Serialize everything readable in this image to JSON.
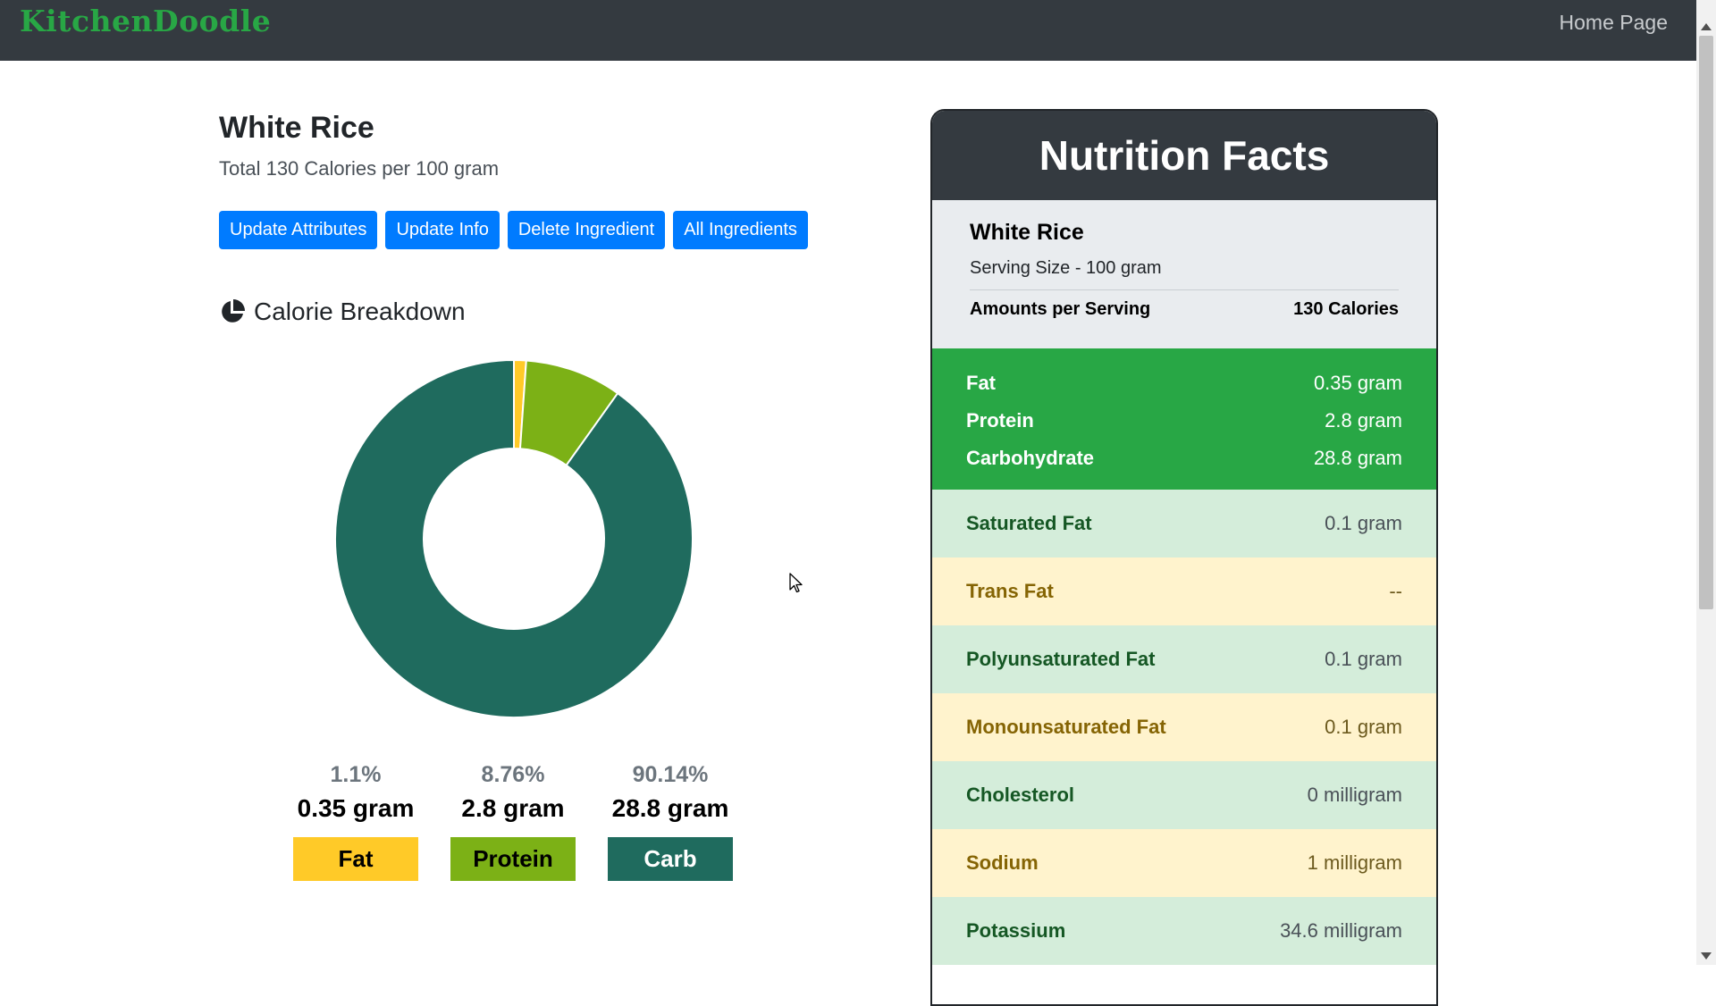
{
  "navbar": {
    "brand": "KitchenDoodle",
    "home_link": "Home Page"
  },
  "ingredient": {
    "name": "White Rice",
    "subtitle": "Total 130 Calories per 100 gram"
  },
  "actions": [
    "Update Attributes",
    "Update Info",
    "Delete Ingredient",
    "All Ingredients"
  ],
  "breakdown": {
    "title": "Calorie Breakdown",
    "icon": "chart-pie-icon",
    "items": [
      {
        "pct": "1.1%",
        "grams": "0.35 gram",
        "label": "Fat",
        "color": "#ffca28",
        "text_color": "#000000"
      },
      {
        "pct": "8.76%",
        "grams": "2.8 gram",
        "label": "Protein",
        "color": "#7cb116",
        "text_color": "#000000"
      },
      {
        "pct": "90.14%",
        "grams": "28.8 gram",
        "label": "Carb",
        "color": "#1f6b5e",
        "text_color": "#ffffff"
      }
    ]
  },
  "chart_data": {
    "type": "pie",
    "categories": [
      "Fat",
      "Protein",
      "Carb"
    ],
    "values": [
      1.1,
      8.76,
      90.14
    ],
    "colors": [
      "#ffca28",
      "#7cb116",
      "#1f6b5e"
    ],
    "donut": true,
    "title": ""
  },
  "facts": {
    "header": "Nutrition Facts",
    "name": "White Rice",
    "serving": "Serving Size - 100 gram",
    "amounts_label": "Amounts per Serving",
    "calories": "130 Calories",
    "macros": [
      {
        "label": "Fat",
        "value": "0.35 gram"
      },
      {
        "label": "Protein",
        "value": "2.8 gram"
      },
      {
        "label": "Carbohydrate",
        "value": "28.8 gram"
      }
    ],
    "details": [
      {
        "label": "Saturated Fat",
        "value": "0.1 gram",
        "tone": "green"
      },
      {
        "label": "Trans Fat",
        "value": "--",
        "tone": "yellow"
      },
      {
        "label": "Polyunsaturated Fat",
        "value": "0.1 gram",
        "tone": "green"
      },
      {
        "label": "Monounsaturated Fat",
        "value": "0.1 gram",
        "tone": "yellow"
      },
      {
        "label": "Cholesterol",
        "value": "0 milligram",
        "tone": "green"
      },
      {
        "label": "Sodium",
        "value": "1 milligram",
        "tone": "yellow"
      },
      {
        "label": "Potassium",
        "value": "34.6 milligram",
        "tone": "green"
      }
    ]
  }
}
